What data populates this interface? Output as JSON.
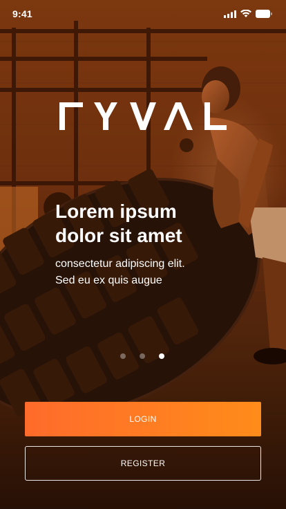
{
  "status_bar": {
    "time": "9:41",
    "icons": [
      "signal-icon",
      "wifi-icon",
      "battery-icon"
    ]
  },
  "brand": {
    "logo_text": "RYVAL",
    "accent_color": "#ff7a22"
  },
  "hero": {
    "title_line1": "Lorem ipsum",
    "title_line2": "dolor sit amet",
    "subtitle_line1": "consectetur adipiscing elit.",
    "subtitle_line2": "Sed eu ex quis augue"
  },
  "pager": {
    "total": 3,
    "active_index": 2
  },
  "actions": {
    "login_label": "LOGIN",
    "register_label": "REGISTER"
  }
}
